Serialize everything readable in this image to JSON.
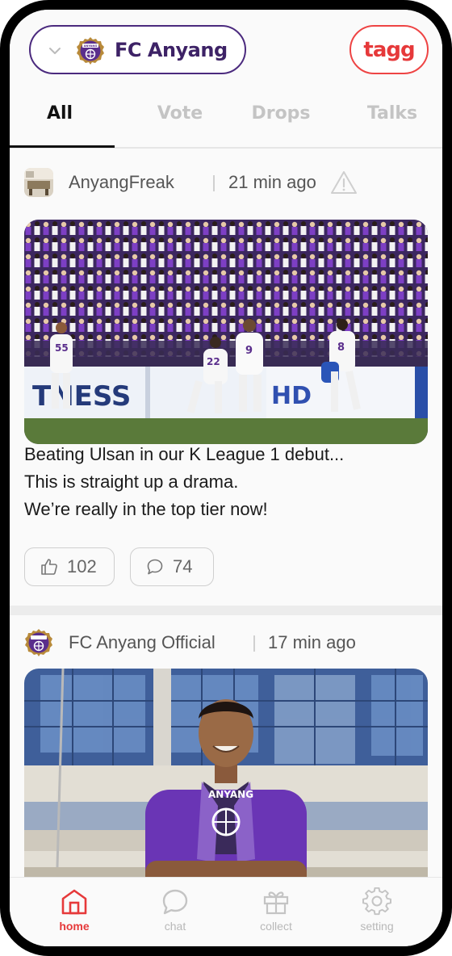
{
  "header": {
    "team_name": "FC Anyang",
    "crest_text": "ANYANG",
    "brand": "tagg"
  },
  "tabs": [
    {
      "label": "All",
      "active": true
    },
    {
      "label": "Vote",
      "active": false
    },
    {
      "label": "Drops",
      "active": false
    },
    {
      "label": "Talks",
      "active": false
    }
  ],
  "posts": [
    {
      "author": "AnyangFreak",
      "time": "21 min ago",
      "image_subject": "players-celebrating-goal",
      "image_texts": {
        "banner_left": "TNESS",
        "banner_right": "HD",
        "jersey_1": "55",
        "jersey_2": "22",
        "jersey_3": "9",
        "jersey_4": "8"
      },
      "text_lines": [
        "Beating Ulsan in our K League 1 debut...",
        "This is straight up a drama.",
        "We’re really in the top tier now!"
      ],
      "likes": "102",
      "comments": "74"
    },
    {
      "author": "FC Anyang Official",
      "time": "17 min ago",
      "image_subject": "player-portrait-with-scarf",
      "image_texts": {
        "jersey_text": "ANYANG"
      }
    }
  ],
  "nav": [
    {
      "label": "home",
      "icon": "home-icon",
      "active": true
    },
    {
      "label": "chat",
      "icon": "chat-icon",
      "active": false
    },
    {
      "label": "collect",
      "icon": "gift-icon",
      "active": false
    },
    {
      "label": "setting",
      "icon": "gear-icon",
      "active": false
    }
  ],
  "colors": {
    "brand_red": "#e6393a",
    "team_purple": "#4b2a7e",
    "tab_inactive": "#c4c4c4"
  }
}
